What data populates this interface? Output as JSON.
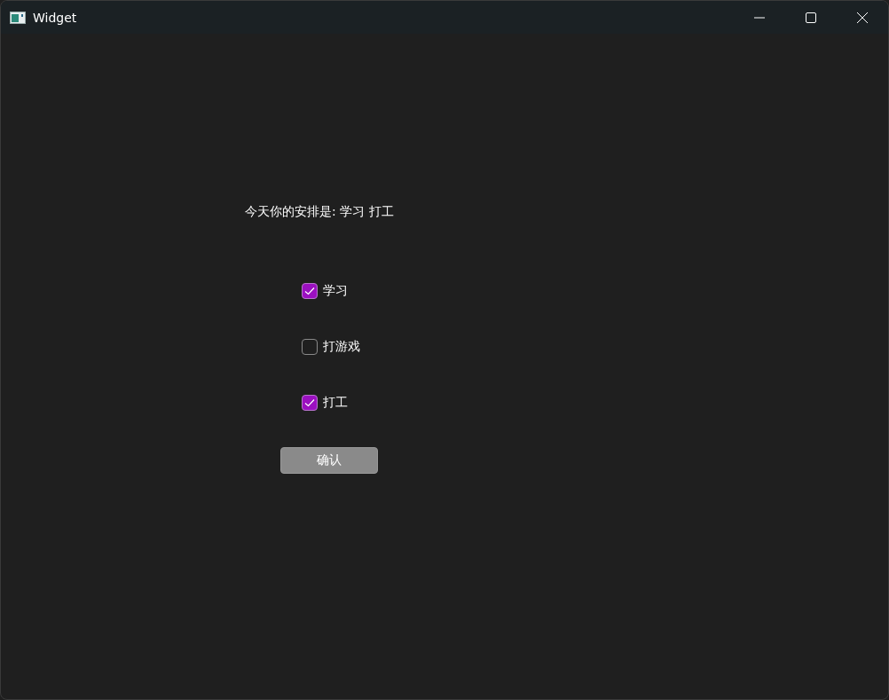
{
  "window": {
    "title": "Widget"
  },
  "summary": "今天你的安排是: 学习 打工",
  "options": [
    {
      "label": "学习",
      "checked": true
    },
    {
      "label": "打游戏",
      "checked": false
    },
    {
      "label": "打工",
      "checked": true
    }
  ],
  "button": "确认"
}
